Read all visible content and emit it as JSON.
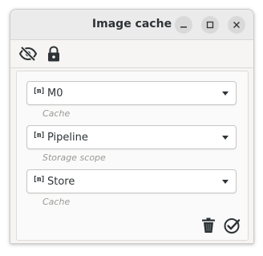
{
  "window": {
    "title": "Image cache"
  },
  "titlebar_buttons": {
    "minimize_icon": "minimize-icon",
    "maximize_icon": "maximize-icon",
    "close_icon": "close-icon"
  },
  "toolbar": {
    "visibility_icon": "eye-off-icon",
    "lock_icon": "lock-icon"
  },
  "fields": [
    {
      "marker": "[m]",
      "value": "M0",
      "hint": "Cache"
    },
    {
      "marker": "[m]",
      "value": "Pipeline",
      "hint": "Storage scope"
    },
    {
      "marker": "[m]",
      "value": "Store",
      "hint": "Cache"
    }
  ],
  "actions": {
    "delete_icon": "trash-icon",
    "confirm_icon": "check-circle-icon"
  },
  "colors": {
    "text": "#2e3436",
    "hint": "#9a9996",
    "window_bg": "#f6f5f4",
    "titlebar_bg": "#ebebeb"
  }
}
